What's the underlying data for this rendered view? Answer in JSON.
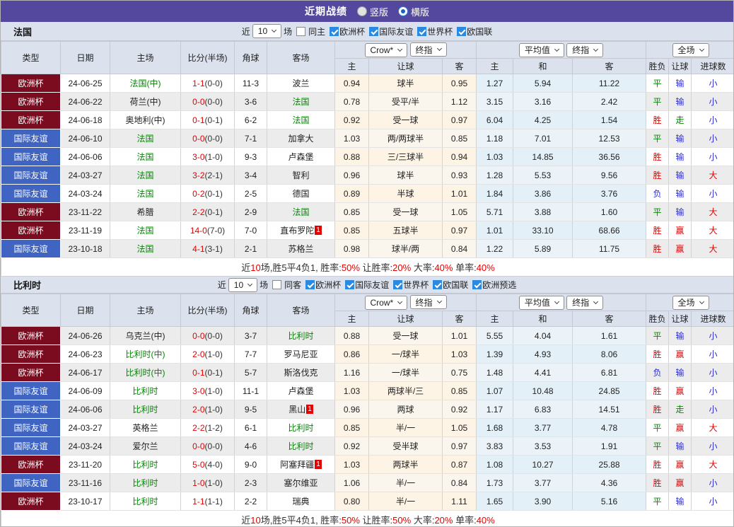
{
  "title_bar": {
    "title": "近期战绩",
    "vertical_label": "竖版",
    "horizontal_label": "横版",
    "selected": "横版"
  },
  "filter_labels": {
    "near": "近",
    "games_value": "10",
    "unit": "场"
  },
  "table_header": {
    "type": "类型",
    "date": "日期",
    "home": "主场",
    "score": "比分(半场)",
    "corners": "角球",
    "away": "客场",
    "odds_company": "Crow*",
    "odds_stage": "终指",
    "avg_company": "平均值",
    "avg_stage": "终指",
    "scope": "全场",
    "sub_home": "主",
    "sub_handicap": "让球",
    "sub_away": "客",
    "sub_avg_home": "主",
    "sub_avg_draw": "和",
    "sub_avg_away": "客",
    "sub_result": "胜负",
    "sub_handicap_result": "让球",
    "sub_goals": "进球数"
  },
  "colors": {
    "accent_purple": "#54489e",
    "header_bg": "#dce2ed",
    "type_colors": {
      "欧洲杯": "#7b0c1f",
      "国际友谊": "#4064c2"
    },
    "result_colors": {
      "胜": "#e60000",
      "平": "#008800",
      "负": "#2b2bd5",
      "赢": "#e60000",
      "走": "#008800",
      "输": "#2b2bd5",
      "大": "#e60000",
      "小": "#2b2bd5"
    },
    "team_highlight": "#008800",
    "score_red": "#e60000"
  },
  "icons": {
    "dropdown": "chevron-down",
    "checkbox_checked": "checkmark",
    "radio_selected": "dot"
  },
  "sections": [
    {
      "team": "法国",
      "same_filter_label": "同主",
      "same_filter_checked": false,
      "competitions": [
        "欧洲杯",
        "国际友谊",
        "世界杯",
        "欧国联"
      ],
      "stripe_offset": 0,
      "bar_class": "h27",
      "rows": [
        {
          "type": "欧洲杯",
          "date": "24-06-25",
          "home": "法国(中)",
          "home_active": true,
          "score": "1-1",
          "half": "(0-0)",
          "corners": "11-3",
          "away": "波兰",
          "away_active": false,
          "away_badge": "",
          "odds_home": "0.94",
          "handicap": "球半",
          "odds_away": "0.95",
          "avg_home": "1.27",
          "avg_draw": "5.94",
          "avg_away": "11.22",
          "result": "平",
          "handicap_result": "输",
          "goals": "小"
        },
        {
          "type": "欧洲杯",
          "date": "24-06-22",
          "home": "荷兰(中)",
          "home_active": false,
          "score": "0-0",
          "half": "(0-0)",
          "corners": "3-6",
          "away": "法国",
          "away_active": true,
          "away_badge": "",
          "odds_home": "0.78",
          "handicap": "受平/半",
          "odds_away": "1.12",
          "avg_home": "3.15",
          "avg_draw": "3.16",
          "avg_away": "2.42",
          "result": "平",
          "handicap_result": "输",
          "goals": "小"
        },
        {
          "type": "欧洲杯",
          "date": "24-06-18",
          "home": "奥地利(中)",
          "home_active": false,
          "score": "0-1",
          "half": "(0-1)",
          "corners": "6-2",
          "away": "法国",
          "away_active": true,
          "away_badge": "",
          "odds_home": "0.92",
          "handicap": "受一球",
          "odds_away": "0.97",
          "avg_home": "6.04",
          "avg_draw": "4.25",
          "avg_away": "1.54",
          "result": "胜",
          "handicap_result": "走",
          "goals": "小"
        },
        {
          "type": "国际友谊",
          "date": "24-06-10",
          "home": "法国",
          "home_active": true,
          "score": "0-0",
          "half": "(0-0)",
          "corners": "7-1",
          "away": "加拿大",
          "away_active": false,
          "away_badge": "",
          "odds_home": "1.03",
          "handicap": "两/两球半",
          "odds_away": "0.85",
          "avg_home": "1.18",
          "avg_draw": "7.01",
          "avg_away": "12.53",
          "result": "平",
          "handicap_result": "输",
          "goals": "小"
        },
        {
          "type": "国际友谊",
          "date": "24-06-06",
          "home": "法国",
          "home_active": true,
          "score": "3-0",
          "half": "(1-0)",
          "corners": "9-3",
          "away": "卢森堡",
          "away_active": false,
          "away_badge": "",
          "odds_home": "0.88",
          "handicap": "三/三球半",
          "odds_away": "0.94",
          "avg_home": "1.03",
          "avg_draw": "14.85",
          "avg_away": "36.56",
          "result": "胜",
          "handicap_result": "输",
          "goals": "小"
        },
        {
          "type": "国际友谊",
          "date": "24-03-27",
          "home": "法国",
          "home_active": true,
          "score": "3-2",
          "half": "(2-1)",
          "corners": "3-4",
          "away": "智利",
          "away_active": false,
          "away_badge": "",
          "odds_home": "0.96",
          "handicap": "球半",
          "odds_away": "0.93",
          "avg_home": "1.28",
          "avg_draw": "5.53",
          "avg_away": "9.56",
          "result": "胜",
          "handicap_result": "输",
          "goals": "大"
        },
        {
          "type": "国际友谊",
          "date": "24-03-24",
          "home": "法国",
          "home_active": true,
          "score": "0-2",
          "half": "(0-1)",
          "corners": "2-5",
          "away": "德国",
          "away_active": false,
          "away_badge": "",
          "odds_home": "0.89",
          "handicap": "半球",
          "odds_away": "1.01",
          "avg_home": "1.84",
          "avg_draw": "3.86",
          "avg_away": "3.76",
          "result": "负",
          "handicap_result": "输",
          "goals": "小"
        },
        {
          "type": "欧洲杯",
          "date": "23-11-22",
          "home": "希腊",
          "home_active": false,
          "score": "2-2",
          "half": "(0-1)",
          "corners": "2-9",
          "away": "法国",
          "away_active": true,
          "away_badge": "",
          "odds_home": "0.85",
          "handicap": "受一球",
          "odds_away": "1.05",
          "avg_home": "5.71",
          "avg_draw": "3.88",
          "avg_away": "1.60",
          "result": "平",
          "handicap_result": "输",
          "goals": "大"
        },
        {
          "type": "欧洲杯",
          "date": "23-11-19",
          "home": "法国",
          "home_active": true,
          "score": "14-0",
          "half": "(7-0)",
          "corners": "7-0",
          "away": "直布罗陀",
          "away_active": false,
          "away_badge": "1",
          "odds_home": "0.85",
          "handicap": "五球半",
          "odds_away": "0.97",
          "avg_home": "1.01",
          "avg_draw": "33.10",
          "avg_away": "68.66",
          "result": "胜",
          "handicap_result": "赢",
          "goals": "大"
        },
        {
          "type": "国际友谊",
          "date": "23-10-18",
          "home": "法国",
          "home_active": true,
          "score": "4-1",
          "half": "(3-1)",
          "corners": "2-1",
          "away": "苏格兰",
          "away_active": false,
          "away_badge": "",
          "odds_home": "0.98",
          "handicap": "球半/两",
          "odds_away": "0.84",
          "avg_home": "1.22",
          "avg_draw": "5.89",
          "avg_away": "11.75",
          "result": "胜",
          "handicap_result": "赢",
          "goals": "大"
        }
      ],
      "summary": [
        [
          "近",
          "k"
        ],
        [
          "10",
          "r"
        ],
        [
          "场,胜5平4负1, 胜率:",
          "k"
        ],
        [
          "50%",
          "r"
        ],
        [
          " 让胜率:",
          "k"
        ],
        [
          "20%",
          "r"
        ],
        [
          " 大率:",
          "k"
        ],
        [
          "40%",
          "r"
        ],
        [
          " 单率:",
          "k"
        ],
        [
          "40%",
          "r"
        ]
      ]
    },
    {
      "team": "比利时",
      "same_filter_label": "同客",
      "same_filter_checked": false,
      "competitions": [
        "欧洲杯",
        "国际友谊",
        "世界杯",
        "欧国联",
        "欧洲预选"
      ],
      "stripe_offset": 1,
      "bar_class": "h24",
      "rows": [
        {
          "type": "欧洲杯",
          "date": "24-06-26",
          "home": "乌克兰(中)",
          "home_active": false,
          "score": "0-0",
          "half": "(0-0)",
          "corners": "3-7",
          "away": "比利时",
          "away_active": true,
          "away_badge": "",
          "odds_home": "0.88",
          "handicap": "受一球",
          "odds_away": "1.01",
          "avg_home": "5.55",
          "avg_draw": "4.04",
          "avg_away": "1.61",
          "result": "平",
          "handicap_result": "输",
          "goals": "小"
        },
        {
          "type": "欧洲杯",
          "date": "24-06-23",
          "home": "比利时(中)",
          "home_active": true,
          "score": "2-0",
          "half": "(1-0)",
          "corners": "7-7",
          "away": "罗马尼亚",
          "away_active": false,
          "away_badge": "",
          "odds_home": "0.86",
          "handicap": "一/球半",
          "odds_away": "1.03",
          "avg_home": "1.39",
          "avg_draw": "4.93",
          "avg_away": "8.06",
          "result": "胜",
          "handicap_result": "赢",
          "goals": "小"
        },
        {
          "type": "欧洲杯",
          "date": "24-06-17",
          "home": "比利时(中)",
          "home_active": true,
          "score": "0-1",
          "half": "(0-1)",
          "corners": "5-7",
          "away": "斯洛伐克",
          "away_active": false,
          "away_badge": "",
          "odds_home": "1.16",
          "handicap": "一/球半",
          "odds_away": "0.75",
          "avg_home": "1.48",
          "avg_draw": "4.41",
          "avg_away": "6.81",
          "result": "负",
          "handicap_result": "输",
          "goals": "小"
        },
        {
          "type": "国际友谊",
          "date": "24-06-09",
          "home": "比利时",
          "home_active": true,
          "score": "3-0",
          "half": "(1-0)",
          "corners": "11-1",
          "away": "卢森堡",
          "away_active": false,
          "away_badge": "",
          "odds_home": "1.03",
          "handicap": "两球半/三",
          "odds_away": "0.85",
          "avg_home": "1.07",
          "avg_draw": "10.48",
          "avg_away": "24.85",
          "result": "胜",
          "handicap_result": "赢",
          "goals": "小"
        },
        {
          "type": "国际友谊",
          "date": "24-06-06",
          "home": "比利时",
          "home_active": true,
          "score": "2-0",
          "half": "(1-0)",
          "corners": "9-5",
          "away": "黑山",
          "away_active": false,
          "away_badge": "1",
          "odds_home": "0.96",
          "handicap": "两球",
          "odds_away": "0.92",
          "avg_home": "1.17",
          "avg_draw": "6.83",
          "avg_away": "14.51",
          "result": "胜",
          "handicap_result": "走",
          "goals": "小"
        },
        {
          "type": "国际友谊",
          "date": "24-03-27",
          "home": "英格兰",
          "home_active": false,
          "score": "2-2",
          "half": "(1-2)",
          "corners": "6-1",
          "away": "比利时",
          "away_active": true,
          "away_badge": "",
          "odds_home": "0.85",
          "handicap": "半/一",
          "odds_away": "1.05",
          "avg_home": "1.68",
          "avg_draw": "3.77",
          "avg_away": "4.78",
          "result": "平",
          "handicap_result": "赢",
          "goals": "大"
        },
        {
          "type": "国际友谊",
          "date": "24-03-24",
          "home": "爱尔兰",
          "home_active": false,
          "score": "0-0",
          "half": "(0-0)",
          "corners": "4-6",
          "away": "比利时",
          "away_active": true,
          "away_badge": "",
          "odds_home": "0.92",
          "handicap": "受半球",
          "odds_away": "0.97",
          "avg_home": "3.83",
          "avg_draw": "3.53",
          "avg_away": "1.91",
          "result": "平",
          "handicap_result": "输",
          "goals": "小"
        },
        {
          "type": "欧洲杯",
          "date": "23-11-20",
          "home": "比利时",
          "home_active": true,
          "score": "5-0",
          "half": "(4-0)",
          "corners": "9-0",
          "away": "阿塞拜疆",
          "away_active": false,
          "away_badge": "1",
          "odds_home": "1.03",
          "handicap": "两球半",
          "odds_away": "0.87",
          "avg_home": "1.08",
          "avg_draw": "10.27",
          "avg_away": "25.88",
          "result": "胜",
          "handicap_result": "赢",
          "goals": "大"
        },
        {
          "type": "国际友谊",
          "date": "23-11-16",
          "home": "比利时",
          "home_active": true,
          "score": "1-0",
          "half": "(1-0)",
          "corners": "2-3",
          "away": "塞尔维亚",
          "away_active": false,
          "away_badge": "",
          "odds_home": "1.06",
          "handicap": "半/一",
          "odds_away": "0.84",
          "avg_home": "1.73",
          "avg_draw": "3.77",
          "avg_away": "4.36",
          "result": "胜",
          "handicap_result": "赢",
          "goals": "小"
        },
        {
          "type": "欧洲杯",
          "date": "23-10-17",
          "home": "比利时",
          "home_active": true,
          "score": "1-1",
          "half": "(1-1)",
          "corners": "2-2",
          "away": "瑞典",
          "away_active": false,
          "away_badge": "",
          "odds_home": "0.80",
          "handicap": "半/一",
          "odds_away": "1.11",
          "avg_home": "1.65",
          "avg_draw": "3.90",
          "avg_away": "5.16",
          "result": "平",
          "handicap_result": "输",
          "goals": "小"
        }
      ],
      "summary": [
        [
          "近",
          "k"
        ],
        [
          "10",
          "r"
        ],
        [
          "场,胜5平4负1, 胜率:",
          "k"
        ],
        [
          "50%",
          "r"
        ],
        [
          " 让胜率:",
          "k"
        ],
        [
          "50%",
          "r"
        ],
        [
          " 大率:",
          "k"
        ],
        [
          "20%",
          "r"
        ],
        [
          " 单率:",
          "k"
        ],
        [
          "40%",
          "r"
        ]
      ]
    }
  ]
}
